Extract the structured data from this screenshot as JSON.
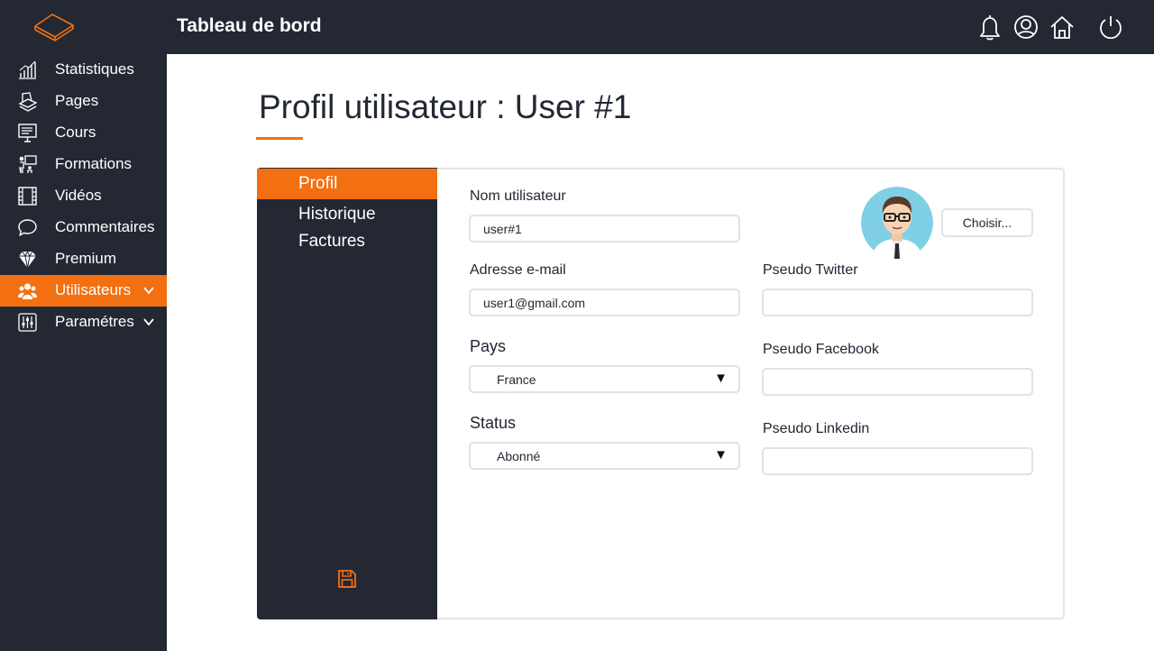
{
  "header": {
    "title": "Tableau de bord",
    "icons": [
      "book-logo-icon",
      "bell-icon",
      "user-icon",
      "home-icon",
      "power-icon"
    ]
  },
  "sidebar": {
    "items": [
      {
        "label": "Statistiques",
        "icon": "chart-icon"
      },
      {
        "label": "Pages",
        "icon": "pages-icon"
      },
      {
        "label": "Cours",
        "icon": "presentation-icon"
      },
      {
        "label": "Formations",
        "icon": "training-icon"
      },
      {
        "label": "Vidéos",
        "icon": "film-icon"
      },
      {
        "label": "Commentaires",
        "icon": "comment-icon"
      },
      {
        "label": "Premium",
        "icon": "diamond-icon"
      },
      {
        "label": "Utilisateurs",
        "icon": "users-icon",
        "active": true,
        "expandable": true
      },
      {
        "label": "Paramétres",
        "icon": "sliders-icon",
        "expandable": true
      }
    ]
  },
  "main": {
    "title": "Profil utilisateur : User #1",
    "tabs": [
      {
        "label": "Profil",
        "active": true
      },
      {
        "label": "Historique"
      },
      {
        "label": "Factures"
      }
    ],
    "form": {
      "username": {
        "label": "Nom utilisateur",
        "value": "user#1"
      },
      "email": {
        "label": "Adresse e-mail",
        "value": "user1@gmail.com"
      },
      "country": {
        "label": "Pays",
        "value": "France"
      },
      "status": {
        "label": "Status",
        "value": "Abonné"
      },
      "twitter": {
        "label": "Pseudo Twitter",
        "value": ""
      },
      "facebook": {
        "label": "Pseudo Facebook",
        "value": ""
      },
      "linkedin": {
        "label": "Pseudo Linkedin",
        "value": ""
      },
      "choose_label": "Choisir..."
    }
  },
  "colors": {
    "accent": "#f27012",
    "dark": "#232833"
  }
}
